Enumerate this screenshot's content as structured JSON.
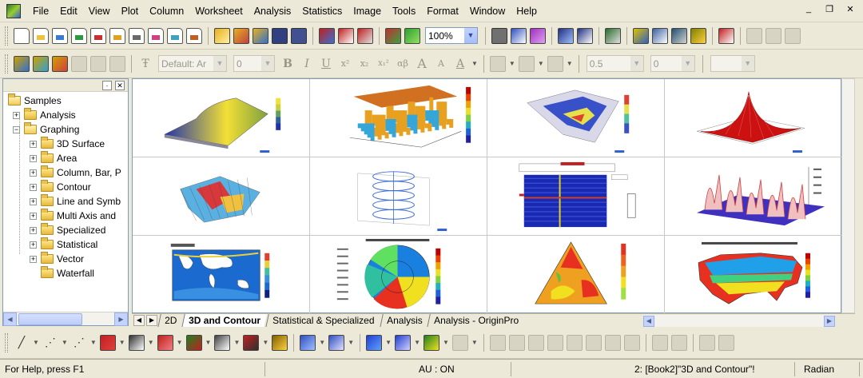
{
  "menu": {
    "items": [
      "File",
      "Edit",
      "View",
      "Plot",
      "Column",
      "Worksheet",
      "Analysis",
      "Statistics",
      "Image",
      "Tools",
      "Format",
      "Window",
      "Help"
    ],
    "window_controls": [
      "minimize-icon",
      "restore-icon",
      "close-icon"
    ]
  },
  "standard_toolbar": {
    "zoom_value": "100%"
  },
  "format_toolbar": {
    "font_name": "Default: Ar",
    "font_size": "0",
    "bold": "B",
    "italic": "I",
    "underline": "U",
    "superscript": "x²",
    "subscript": "x₂",
    "super_sub": "x₁²",
    "greek": "αβ",
    "increase_font": "A",
    "decrease_font": "A",
    "font_color": "A",
    "line_width_value": "0.5",
    "line_size_value": "0"
  },
  "explorer": {
    "root": "Samples",
    "items": [
      {
        "label": "Analysis",
        "level": 1,
        "expander": "+"
      },
      {
        "label": "Graphing",
        "level": 1,
        "expander": "−"
      },
      {
        "label": "3D Surface",
        "level": 2,
        "expander": "+"
      },
      {
        "label": "Area",
        "level": 2,
        "expander": "+"
      },
      {
        "label": "Column, Bar, P",
        "level": 2,
        "expander": "+"
      },
      {
        "label": "Contour",
        "level": 2,
        "expander": "+"
      },
      {
        "label": "Line and Symb",
        "level": 2,
        "expander": "+"
      },
      {
        "label": "Multi Axis and",
        "level": 2,
        "expander": "+"
      },
      {
        "label": "Specialized",
        "level": 2,
        "expander": "+"
      },
      {
        "label": "Statistical",
        "level": 2,
        "expander": "+"
      },
      {
        "label": "Vector",
        "level": 2,
        "expander": "+"
      },
      {
        "label": "Waterfall",
        "level": 2,
        "expander": ""
      }
    ]
  },
  "gallery": {
    "thumbnails": [
      {
        "name": "3d-surface-yellow-blue",
        "kind": "surface",
        "palette": [
          "#2233aa",
          "#f2e035"
        ]
      },
      {
        "name": "3d-bars-with-colormap-plane",
        "kind": "bars3d",
        "palette": [
          "#e8a020",
          "#36a6d8"
        ]
      },
      {
        "name": "3d-surface-colormap-tilted",
        "kind": "tilted",
        "palette": [
          "#3850c8",
          "#e6e04a"
        ]
      },
      {
        "name": "3d-red-peak-surface",
        "kind": "peak",
        "palette": [
          "#cc1111",
          "#ffffff"
        ]
      },
      {
        "name": "3d-colored-wireframe",
        "kind": "wire",
        "palette": [
          "#d8383c",
          "#5ab0e0"
        ]
      },
      {
        "name": "3d-helix-scatter",
        "kind": "helix",
        "palette": [
          "#3a6ad8",
          "#aaaaaa"
        ]
      },
      {
        "name": "image-plot-with-profiles",
        "kind": "imageplot",
        "palette": [
          "#1a2ab0",
          "#d04030"
        ]
      },
      {
        "name": "3d-waterfall-red-walls",
        "kind": "waterfall",
        "palette": [
          "#4030c0",
          "#d04040"
        ]
      },
      {
        "name": "world-map-contour",
        "kind": "worldmap",
        "palette": [
          "#1a6ad0",
          "#e8d03a"
        ]
      },
      {
        "name": "polar-contour-temperature",
        "kind": "polar",
        "palette": [
          "#1540d0",
          "#e83020"
        ]
      },
      {
        "name": "ternary-contour",
        "kind": "ternary",
        "palette": [
          "#e83020",
          "#f0e020"
        ]
      },
      {
        "name": "us-map-contour",
        "kind": "usmap",
        "palette": [
          "#e83020",
          "#20a0e8"
        ]
      }
    ]
  },
  "sheet_tabs": [
    "2D",
    "3D and Contour",
    "Statistical & Specialized",
    "Analysis",
    "Analysis - OriginPro"
  ],
  "active_tab_index": 1,
  "status": {
    "help_text": "For Help, press F1",
    "au": "AU : ON",
    "active_book": "2: [Book2]\"3D and Contour\"!",
    "angle_unit": "Radian"
  }
}
